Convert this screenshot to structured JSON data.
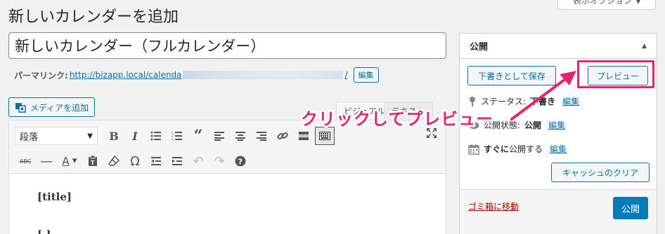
{
  "page": {
    "title": "新しいカレンダーを追加",
    "screen_options_label": "表示オプション"
  },
  "post": {
    "title_value": "新しいカレンダー（フルカレンダー）",
    "permalink_label": "パーマリンク:",
    "permalink_url": "http://bizapp.local/calenda",
    "permalink_suffix": "/",
    "permalink_edit": "編集"
  },
  "editor": {
    "add_media_label": "メディアを追加",
    "tab_visual": "ビジュアル",
    "tab_text": "テキスト",
    "format_select_value": "段落",
    "content_line1": "[title]",
    "content_line2": "[  ]"
  },
  "toolbar": {
    "row1": [
      {
        "name": "bold-icon",
        "glyph": "B"
      },
      {
        "name": "italic-icon",
        "glyph": "I"
      },
      {
        "name": "bullet-list-icon",
        "glyph": "☰"
      },
      {
        "name": "numbered-list-icon",
        "glyph": "≡"
      },
      {
        "name": "blockquote-icon",
        "glyph": "❝"
      },
      {
        "name": "align-left-icon",
        "glyph": "☰"
      },
      {
        "name": "align-center-icon",
        "glyph": "≡"
      },
      {
        "name": "align-right-icon",
        "glyph": "☰"
      },
      {
        "name": "link-icon",
        "glyph": "🔗"
      },
      {
        "name": "read-more-icon",
        "glyph": "▬"
      },
      {
        "name": "toolbar-toggle-icon",
        "glyph": "▦"
      }
    ],
    "row2": [
      {
        "name": "strikethrough-icon",
        "glyph": "ᴬᴮᶜ"
      },
      {
        "name": "horizontal-line-icon",
        "glyph": "—"
      },
      {
        "name": "text-color-icon",
        "glyph": "A▾"
      },
      {
        "name": "paste-text-icon",
        "glyph": "📋"
      },
      {
        "name": "clear-formatting-icon",
        "glyph": "⌫"
      },
      {
        "name": "special-character-icon",
        "glyph": "Ω"
      },
      {
        "name": "outdent-icon",
        "glyph": "⇤"
      },
      {
        "name": "indent-icon",
        "glyph": "⇥"
      },
      {
        "name": "undo-icon",
        "glyph": "↶"
      },
      {
        "name": "redo-icon",
        "glyph": "↷"
      },
      {
        "name": "help-icon",
        "glyph": "?"
      }
    ]
  },
  "publish": {
    "heading": "公開",
    "save_draft_label": "下書きとして保存",
    "preview_label": "プレビュー",
    "status_label": "ステータス:",
    "status_value": "下書き",
    "visibility_label": "公開状態:",
    "visibility_value": "公開",
    "schedule_prefix": "すぐに",
    "schedule_suffix": "公開する",
    "edit_label": "編集",
    "clear_cache_label": "キャッシュのクリア",
    "trash_label": "ゴミ箱に移動",
    "publish_label": "公開"
  },
  "annotation": {
    "text": "クリックしてプレビュー",
    "color": "#e5246d"
  }
}
